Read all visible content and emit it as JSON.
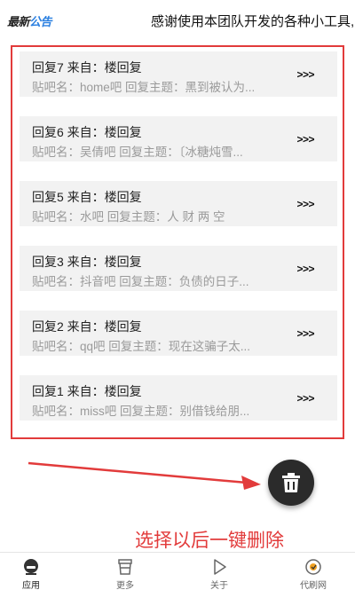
{
  "notice": {
    "logo_part1": "最新",
    "logo_part2": "公告",
    "text": "感谢使用本团队开发的各种小工具,"
  },
  "replies": [
    {
      "title": "回复7  来自：楼回复",
      "subtitle": "贴吧名：home吧   回复主题：黑到被认为...",
      "arrow": ">>>"
    },
    {
      "title": "回复6  来自：楼回复",
      "subtitle": "贴吧名：吴倩吧   回复主题：〔冰糖炖雪...",
      "arrow": ">>>"
    },
    {
      "title": "回复5  来自：楼回复",
      "subtitle": "贴吧名：水吧   回复主题：人 财 两 空",
      "arrow": ">>>"
    },
    {
      "title": "回复3  来自：楼回复",
      "subtitle": "贴吧名：抖音吧   回复主题：负债的日子...",
      "arrow": ">>>"
    },
    {
      "title": "回复2  来自：楼回复",
      "subtitle": "贴吧名：qq吧   回复主题：现在这骗子太...",
      "arrow": ">>>"
    },
    {
      "title": "回复1  来自：楼回复",
      "subtitle": "贴吧名：miss吧   回复主题：别借钱给朋...",
      "arrow": ">>>"
    }
  ],
  "caption": "选择以后一键删除",
  "tabs": [
    {
      "label": "应用",
      "icon": "app-icon"
    },
    {
      "label": "更多",
      "icon": "cup-icon"
    },
    {
      "label": "关于",
      "icon": "play-icon"
    },
    {
      "label": "代刷网",
      "icon": "badge-icon"
    }
  ],
  "colors": {
    "highlight_red": "#e23b3b",
    "fab_bg": "#2b2b2b",
    "item_bg": "#f2f2f2"
  }
}
